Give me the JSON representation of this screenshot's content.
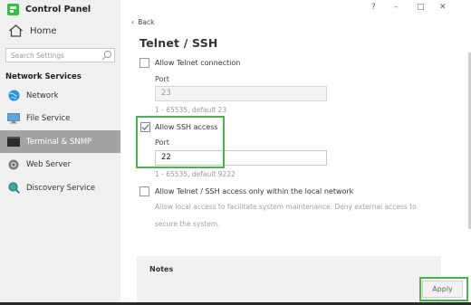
{
  "app": {
    "title": "Control Panel"
  },
  "window_controls": {
    "help": "?",
    "minimize": "–",
    "maximize": "□",
    "close": "✕"
  },
  "sidebar": {
    "home_label": "Home",
    "search": {
      "placeholder": "Search Settings"
    },
    "section_title": "Network Services",
    "items": [
      {
        "label": "Network",
        "icon": "globe-icon",
        "active": false
      },
      {
        "label": "File Service",
        "icon": "monitor-icon",
        "active": false
      },
      {
        "label": "Terminal & SNMP",
        "icon": "terminal-icon",
        "active": true
      },
      {
        "label": "Web Server",
        "icon": "web-server-icon",
        "active": false
      },
      {
        "label": "Discovery Service",
        "icon": "discovery-icon",
        "active": false
      }
    ]
  },
  "main": {
    "back_label": "Back",
    "title": "Telnet / SSH",
    "telnet": {
      "checkbox_label": "Allow Telnet connection",
      "checked": false,
      "port_label": "Port",
      "port_value": "23",
      "hint": "1 - 65535, default 23"
    },
    "ssh": {
      "checkbox_label": "Allow SSH access",
      "checked": true,
      "port_label": "Port",
      "port_value": "22",
      "hint": "1 - 65535, default 9222"
    },
    "local_only": {
      "checkbox_label": "Allow Telnet / SSH access only within the local network",
      "checked": false,
      "description": "Allow local access to facilitate system maintenance. Deny external access to secure the system."
    },
    "notes": {
      "title": "Notes"
    },
    "apply_label": "Apply"
  },
  "colors": {
    "highlight": "#49b34d",
    "logo": "#43b649",
    "active_nav": "#a3a3a3"
  }
}
